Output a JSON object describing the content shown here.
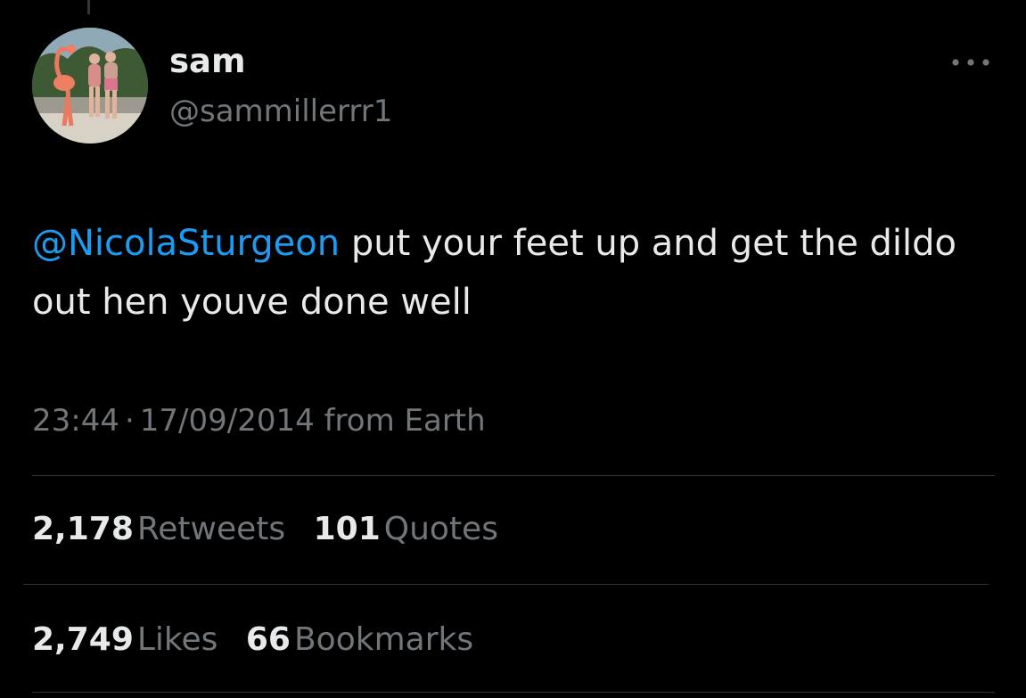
{
  "colors": {
    "background": "#000000",
    "text_primary": "#e7e9ea",
    "text_secondary": "#71767b",
    "mention": "#1d9bf0",
    "divider": "#2f3336"
  },
  "tweet": {
    "author": {
      "display_name": "sam",
      "handle": "@sammillerrr1",
      "avatar_icon": "profile-photo-flamingo-beach"
    },
    "more_icon": "more-options-icon",
    "mention": "@NicolaSturgeon",
    "body": " put your feet up and get the dildo out hen youve done well",
    "time": "23:44",
    "separator": "·",
    "date": "17/09/2014",
    "source": "from Earth"
  },
  "stats": {
    "retweets": {
      "count": "2,178",
      "label": "Retweets"
    },
    "quotes": {
      "count": "101",
      "label": "Quotes"
    },
    "likes": {
      "count": "2,749",
      "label": "Likes"
    },
    "bookmarks": {
      "count": "66",
      "label": "Bookmarks"
    }
  }
}
